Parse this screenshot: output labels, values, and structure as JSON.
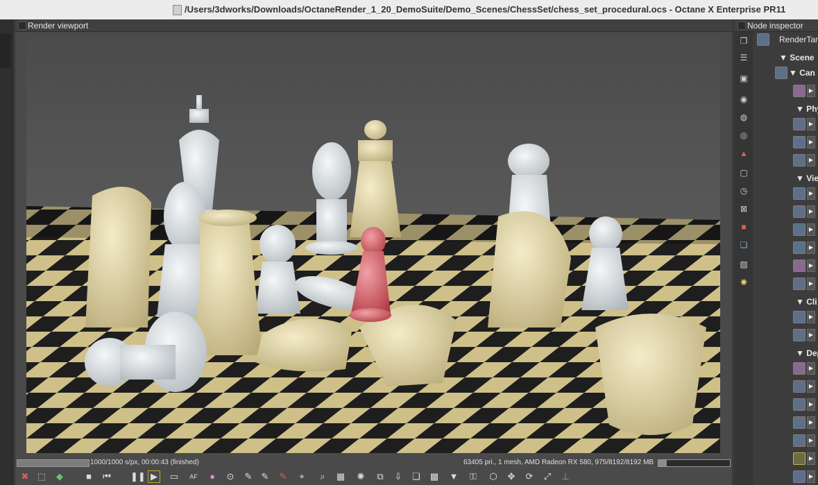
{
  "window": {
    "title": "/Users/3dworks/Downloads/OctaneRender_1_20_DemoSuite/Demo_Scenes/ChessSet/chess_set_procedural.ocs - Octane X Enterprise PR11"
  },
  "viewport": {
    "header": "Render viewport",
    "render_image": "chess-set-render"
  },
  "status": {
    "progress_fraction": 1.0,
    "left_text": "1000/1000 s/px, 00:00:43 (finished)",
    "right_text": "63405 pri., 1 mesh, AMD Radeon RX 580, 975/8192/8192 MB",
    "memory_fraction": 0.12
  },
  "toolbar": {
    "icons": [
      "reset-icon",
      "region-icon",
      "color-cube-icon",
      "stop-icon",
      "rewind-icon",
      "pause-icon",
      "play-icon",
      "display-icon",
      "af-icon",
      "color-wheel-icon",
      "focus-picker-icon",
      "white-balance-icon",
      "material-picker-icon",
      "object-picker-icon",
      "camera-target-icon",
      "zoom-icon",
      "denoise-icon",
      "render-priority-icon",
      "copy-icon",
      "export-icon",
      "layers-icon",
      "checker-icon",
      "gamut-icon",
      "lock-icon",
      "cube-icon",
      "move-icon",
      "rotate-icon",
      "fullscreen-icon",
      "axis-icon"
    ]
  },
  "inspector": {
    "header": "Node inspector",
    "render_target": "RenderTar",
    "scene": "▼ Scene",
    "camera": "▼ Can",
    "sections": [
      "▼ Phy",
      "▼ Vie",
      "▼ Cli",
      "▼ Dep"
    ]
  },
  "colors": {
    "titlebar_bg": "#ececec",
    "panel_bg": "#4a4a4a",
    "accent": "#c9a227"
  }
}
